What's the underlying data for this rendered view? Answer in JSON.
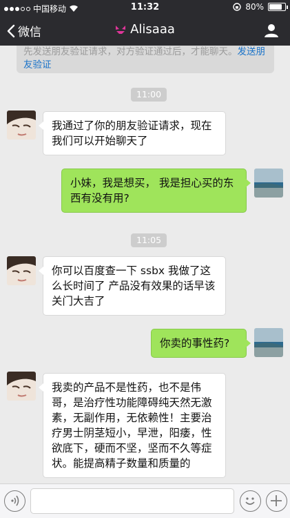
{
  "status_bar": {
    "carrier": "中国移动",
    "time": "11:32",
    "battery": "80%",
    "battery_level": 0.8
  },
  "nav": {
    "back_label": "微信",
    "title": "Alisaaa"
  },
  "notice": {
    "text": "先发送朋友验证请求，对方验证通过后，才能聊天。",
    "link": "发送朋友验证"
  },
  "messages": [
    {
      "type": "time",
      "text": "11:00"
    },
    {
      "type": "in",
      "text": "我通过了你的朋友验证请求，现在我们可以开始聊天了"
    },
    {
      "type": "out",
      "text": "小妹，我是想买， 我是担心买的东西有没有用?"
    },
    {
      "type": "time",
      "text": "11:05"
    },
    {
      "type": "in",
      "text": "你可以百度查一下 ssbx  我做了这么长时间了 产品没有效果的话早该关门大吉了"
    },
    {
      "type": "out",
      "text": "你卖的事性药?"
    },
    {
      "type": "in",
      "text": "我卖的产品不是性药，也不是伟哥，是治疗性功能障碍纯天然无激素，无副作用，无依赖性！主要治疗男士阴茎短小，早泄，阳痿，性欲底下，硬而不坚，坚而不久等症状。能提高精子数量和质量的"
    }
  ],
  "icons": {
    "back": "chevron-left-icon",
    "title_icon": "bikini-icon",
    "profile": "person-icon",
    "voice": "voice-icon",
    "emoji": "emoji-icon",
    "plus": "plus-icon"
  },
  "colors": {
    "nav_bg": "#2b2b2f",
    "chat_bg": "#ebebeb",
    "out_bubble": "#9fe45b",
    "in_bubble": "#ffffff",
    "title_icon": "#e0359a",
    "link": "#1a73c9"
  }
}
